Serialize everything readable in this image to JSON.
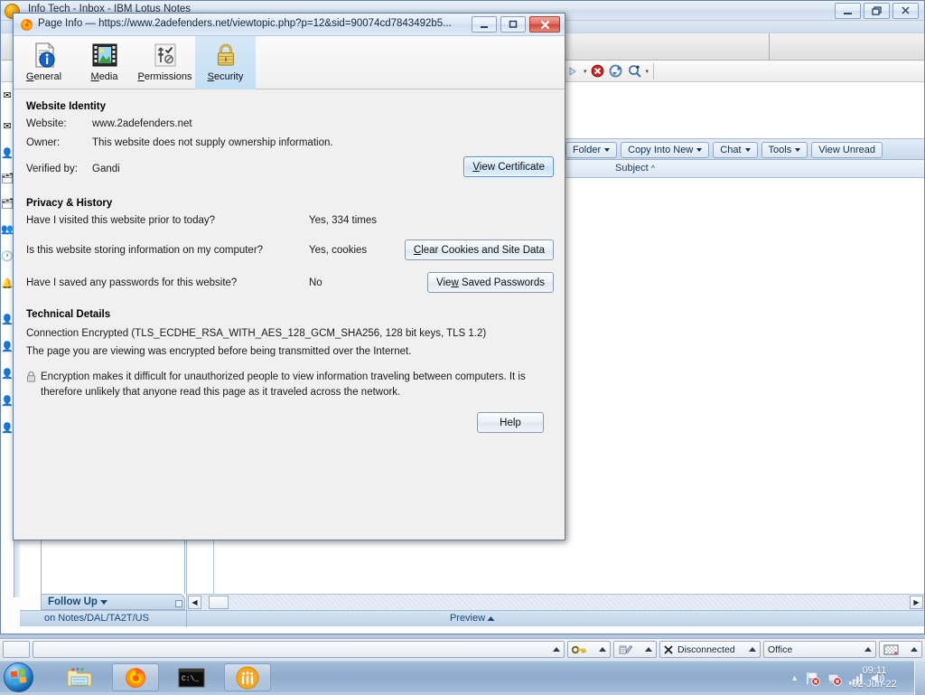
{
  "background_window": {
    "title": "Info Tech - Inbox - IBM Lotus Notes",
    "window_buttons": {
      "minimize": "minimize-icon",
      "restore": "restore-icon",
      "close": "close-icon"
    },
    "toolbar_icons": [
      "forward-arrow-icon",
      "dropdown-arrow-icon",
      "stop-icon",
      "refresh-icon",
      "search-icon",
      "dropdown-arrow-icon"
    ],
    "action_buttons": [
      {
        "label": "Folder",
        "has_caret": true
      },
      {
        "label": "Copy Into New",
        "has_caret": true
      },
      {
        "label": "Chat",
        "has_caret": true
      },
      {
        "label": "Tools",
        "has_caret": true
      },
      {
        "label": "View Unread",
        "has_caret": false
      }
    ],
    "column_headers": [
      {
        "label": "Subject",
        "sort": "^"
      }
    ],
    "follow_up": {
      "label": "Follow Up",
      "has_caret": true
    },
    "status": {
      "left": "on Notes/DAL/TA2T/US",
      "middle": "Preview"
    },
    "rail_icons": [
      "mail-icon",
      "contact-icon",
      "folder-icon",
      "folder-icon",
      "people-icon",
      "clock-icon",
      "bell-icon",
      "person-icon",
      "person-icon",
      "person-icon",
      "person-icon",
      "person-icon"
    ]
  },
  "app_statusbar": {
    "cells": [
      {
        "name": "status-blank-small",
        "label": "",
        "icon": "",
        "caret": false
      },
      {
        "name": "status-message-field",
        "label": "",
        "icon": "",
        "caret": true
      },
      {
        "name": "status-key",
        "label": "",
        "icon": "key-icon",
        "caret": true
      },
      {
        "name": "status-mail",
        "label": "",
        "icon": "mail-pencil-icon",
        "caret": true
      },
      {
        "name": "status-connection",
        "label": "Disconnected",
        "icon": "x-icon",
        "caret": true
      },
      {
        "name": "status-location",
        "label": "Office",
        "icon": "",
        "caret": true
      },
      {
        "name": "status-theme",
        "label": "",
        "icon": "checker-icon",
        "caret": true
      }
    ]
  },
  "taskbar": {
    "start": "windows-start-orb",
    "pinned": [
      {
        "name": "taskbar-explorer",
        "icon": "folder-explorer-icon"
      },
      {
        "name": "taskbar-firefox",
        "icon": "firefox-icon"
      },
      {
        "name": "taskbar-command-prompt",
        "icon": "command-prompt-icon"
      },
      {
        "name": "taskbar-lotus-notes",
        "icon": "lotus-notes-icon"
      }
    ],
    "tray_icons": [
      "show-hidden-icons-icon",
      "flag-error-icon",
      "network-error-icon",
      "signal-icon",
      "volume-icon"
    ],
    "clock_time": "09:11",
    "clock_date": "02-Jun-22"
  },
  "page_info": {
    "title": "Page Info — https://www.2adefenders.net/viewtopic.php?p=12&sid=90074cd7843492b5...",
    "favicon": "firefox-icon",
    "window_buttons": {
      "minimize": "minimize-icon",
      "maximize": "maximize-icon",
      "close": "close-icon"
    },
    "tabs": [
      {
        "label": "General",
        "accel": "G",
        "icon": "page-info-icon",
        "active": false
      },
      {
        "label": "Media",
        "accel": "M",
        "icon": "media-filmstrip-icon",
        "active": false
      },
      {
        "label": "Permissions",
        "accel": "P",
        "icon": "permissions-sliders-icon",
        "active": false
      },
      {
        "label": "Security",
        "accel": "S",
        "icon": "padlock-icon",
        "active": true
      }
    ],
    "website_identity": {
      "heading": "Website Identity",
      "rows": [
        {
          "label": "Website:",
          "value": "www.2adefenders.net"
        },
        {
          "label": "Owner:",
          "value": "This website does not supply ownership information."
        },
        {
          "label": "Verified by:",
          "value": "Gandi"
        }
      ],
      "view_certificate_button": "View Certificate"
    },
    "privacy_history": {
      "heading": "Privacy & History",
      "rows": [
        {
          "label": "Have I visited this website prior to today?",
          "value": "Yes, 334 times",
          "button": ""
        },
        {
          "label": "Is this website storing information on my computer?",
          "value": "Yes, cookies",
          "button": "Clear Cookies and Site Data"
        },
        {
          "label": "Have I saved any passwords for this website?",
          "value": "No",
          "button": "View Saved Passwords"
        }
      ]
    },
    "technical_details": {
      "heading": "Technical Details",
      "line1": "Connection Encrypted (TLS_ECDHE_RSA_WITH_AES_128_GCM_SHA256, 128 bit keys, TLS 1.2)",
      "line2": "The page you are viewing was encrypted before being transmitted over the Internet.",
      "paragraph": "Encryption makes it difficult for unauthorized people to view information traveling between computers. It is therefore unlikely that anyone read this page as it traveled across the network.",
      "help_button": "Help"
    }
  }
}
